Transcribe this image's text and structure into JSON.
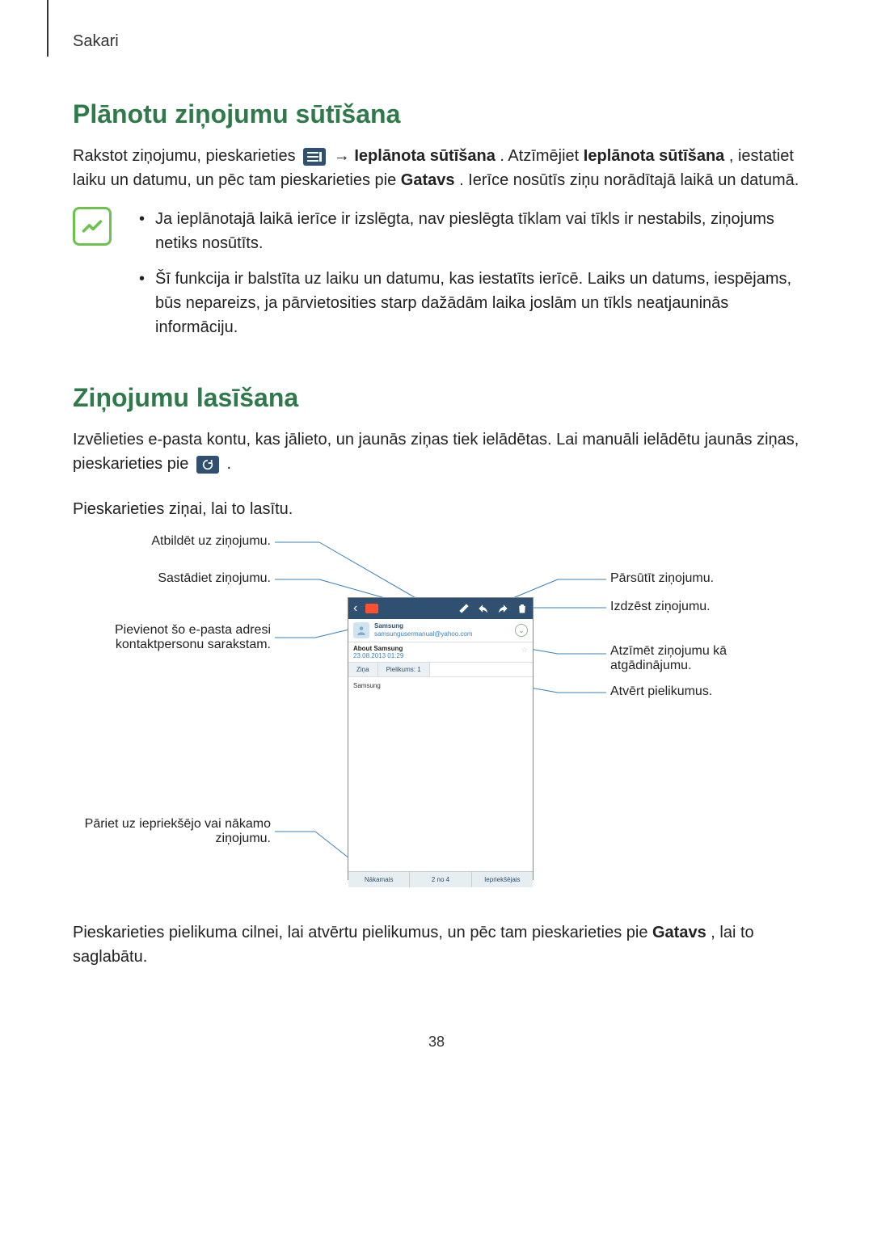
{
  "chapter": "Sakari",
  "section1": {
    "title": "Plānotu ziņojumu sūtīšana",
    "p1a": "Rakstot ziņojumu, pieskarieties ",
    "p1b": " → ",
    "p1_bold1": "Ieplānota sūtīšana",
    "p1c": ". Atzīmējiet ",
    "p1_bold2": "Ieplānota sūtīšana",
    "p1d": ", iestatiet laiku un datumu, un pēc tam pieskarieties pie ",
    "p1_bold3": "Gatavs",
    "p1e": ". Ierīce nosūtīs ziņu norādītajā laikā un datumā.",
    "note1": "Ja ieplānotajā laikā ierīce ir izslēgta, nav pieslēgta tīklam vai tīkls ir nestabils, ziņojums netiks nosūtīts.",
    "note2": "Šī funkcija ir balstīta uz laiku un datumu, kas iestatīts ierīcē. Laiks un datums, iespējams, būs nepareizs, ja pārvietosities starp dažādām laika joslām un tīkls neatjauninās informāciju."
  },
  "section2": {
    "title": "Ziņojumu lasīšana",
    "p1a": "Izvēlieties e-pasta kontu, kas jālieto, un jaunās ziņas tiek ielādētas. Lai manuāli ielādētu jaunās ziņas, pieskarieties pie ",
    "p1b": ".",
    "p2": "Pieskarieties ziņai, lai to lasītu.",
    "p3a": "Pieskarieties pielikuma cilnei, lai atvērtu pielikumus, un pēc tam pieskarieties pie ",
    "p3_bold": "Gatavs",
    "p3b": ", lai to saglabātu."
  },
  "callouts": {
    "reply": "Atbildēt uz ziņojumu.",
    "compose": "Sastādiet ziņojumu.",
    "forward": "Pārsūtīt ziņojumu.",
    "delete": "Izdzēst ziņojumu.",
    "add_contact_l1": "Pievienot šo e-pasta adresi",
    "add_contact_l2": "kontaktpersonu sarakstam.",
    "reminder_l1": "Atzīmēt ziņojumu kā",
    "reminder_l2": "atgādinājumu.",
    "attachments": "Atvērt pielikumus.",
    "navigate_l1": "Pāriet uz iepriekšējo vai nākamo",
    "navigate_l2": "ziņojumu."
  },
  "phone": {
    "sender": "Samsung",
    "email": "samsungusermanual@yahoo.com",
    "subject": "About Samsung",
    "date": "23.08.2013  01:29",
    "tab_msg": "Ziņa",
    "tab_att": "Pielikums: 1",
    "body": "Samsung",
    "nav_next": "Nākamais",
    "nav_count": "2 no 4",
    "nav_prev": "Iepriekšējais"
  },
  "page": "38"
}
